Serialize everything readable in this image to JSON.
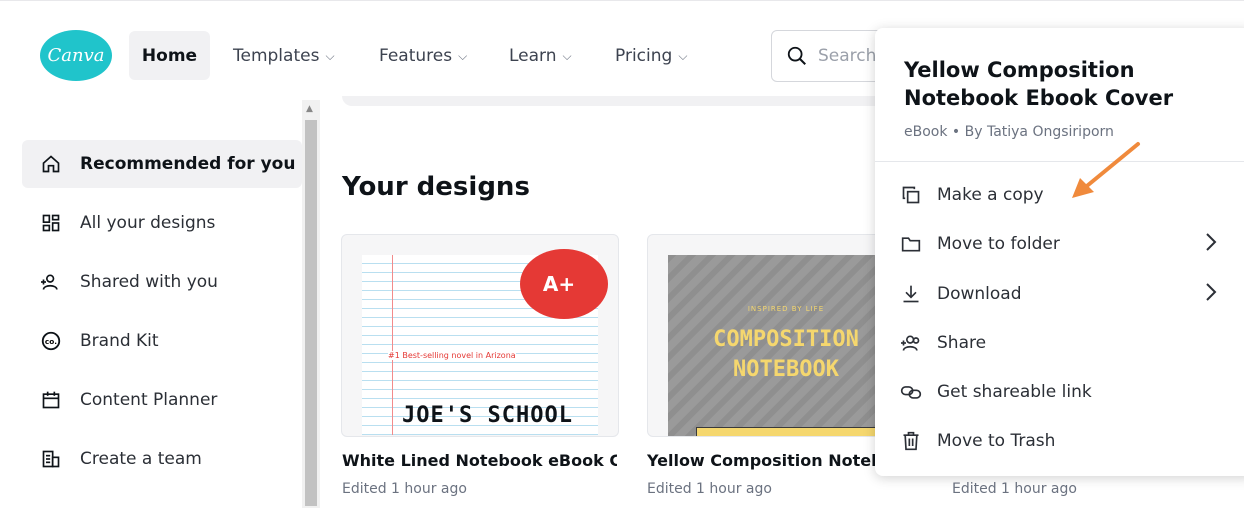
{
  "brand": {
    "logo_text": "Canva",
    "accent": "#20c4cb"
  },
  "nav": {
    "home": "Home",
    "templates": "Templates",
    "features": "Features",
    "learn": "Learn",
    "pricing": "Pricing",
    "search_placeholder": "Search"
  },
  "sidebar": {
    "items": [
      {
        "label": "Recommended for you",
        "icon": "home-icon"
      },
      {
        "label": "All your designs",
        "icon": "grid-icon"
      },
      {
        "label": "Shared with you",
        "icon": "people-icon"
      },
      {
        "label": "Brand Kit",
        "icon": "brand-icon"
      },
      {
        "label": "Content Planner",
        "icon": "calendar-icon"
      },
      {
        "label": "Create a team",
        "icon": "team-icon"
      }
    ]
  },
  "main": {
    "section_title": "Your designs",
    "cards": [
      {
        "title": "White Lined Notebook eBook C...",
        "meta": "Edited 1 hour ago",
        "thumb_badge": "A+",
        "thumb_small": "#1 Best-selling novel in Arizona",
        "thumb_big": "JOE'S SCHOOL"
      },
      {
        "title": "Yellow Composition Notebo",
        "meta": "Edited 1 hour ago",
        "thumb_small": "INSPIRED BY LIFE",
        "thumb_big_1": "COMPOSITION",
        "thumb_big_2": "NOTEBOOK"
      },
      {
        "meta": "Edited 1 hour ago"
      }
    ]
  },
  "popup": {
    "title": "Yellow Composition Notebook Ebook Cover",
    "meta": "eBook • By Tatiya Ongsiriporn",
    "items": [
      {
        "label": "Make a copy",
        "icon": "copy-icon"
      },
      {
        "label": "Move to folder",
        "icon": "folder-icon"
      },
      {
        "label": "Download",
        "icon": "download-icon"
      },
      {
        "label": "Share",
        "icon": "share-icon"
      },
      {
        "label": "Get shareable link",
        "icon": "link-icon"
      },
      {
        "label": "Move to Trash",
        "icon": "trash-icon"
      }
    ]
  },
  "annotation": {
    "arrow_color": "#f08a3c"
  }
}
